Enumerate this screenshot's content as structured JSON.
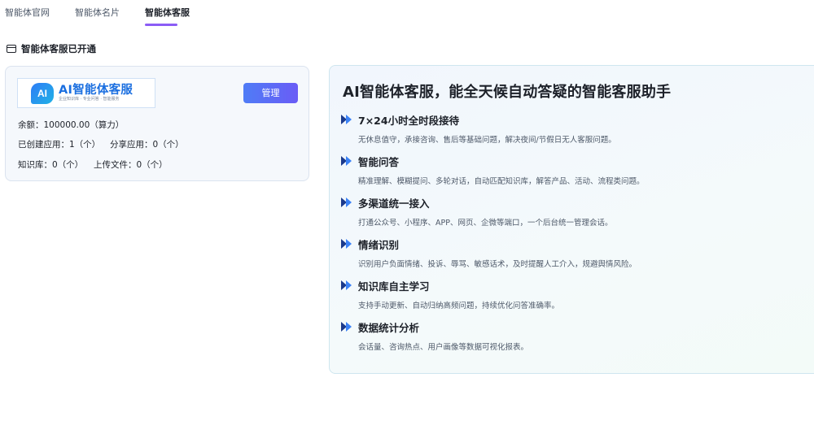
{
  "tabs": [
    {
      "label": "智能体官网"
    },
    {
      "label": "智能体名片"
    },
    {
      "label": "智能体客服"
    }
  ],
  "section": {
    "title": "智能体客服已开通",
    "icon": "card-icon"
  },
  "service_card": {
    "logo": {
      "mark": "AI",
      "title": "AI智能体客服",
      "subtitle": "企业知识库 · 专业问答 · 智能服务"
    },
    "manage_label": "管理",
    "balance": "余额：100000.00（算力）",
    "apps_created": "已创建应用：1（个）",
    "apps_shared": "分享应用：0（个）",
    "knowledge_base": "知识库：0（个）",
    "files_uploaded": "上传文件：0（个）"
  },
  "intro": {
    "title": "AI智能体客服，能全天候自动答疑的智能客服助手",
    "features": [
      {
        "title": "7×24小时全时段接待",
        "desc": "无休息值守，承接咨询、售后等基础问题，解决夜间/节假日无人客服问题。"
      },
      {
        "title": "智能问答",
        "desc": "精准理解、模糊提问、多轮对话，自动匹配知识库，解答产品、活动、流程类问题。"
      },
      {
        "title": "多渠道统一接入",
        "desc": "打通公众号、小程序、APP、网页、企微等端口，一个后台统一管理会话。"
      },
      {
        "title": "情绪识别",
        "desc": "识别用户负面情绪、投诉、辱骂、敏感话术，及时提醒人工介入，规避舆情风险。"
      },
      {
        "title": "知识库自主学习",
        "desc": "支持手动更新、自动归纳高频问题，持续优化问答准确率。"
      },
      {
        "title": "数据统计分析",
        "desc": "会话量、咨询热点、用户画像等数据可视化报表。"
      }
    ]
  },
  "colors": {
    "accent": "#8b5cf6",
    "button": "#5b6ff6",
    "brand_blue": "#1b6fe0"
  }
}
